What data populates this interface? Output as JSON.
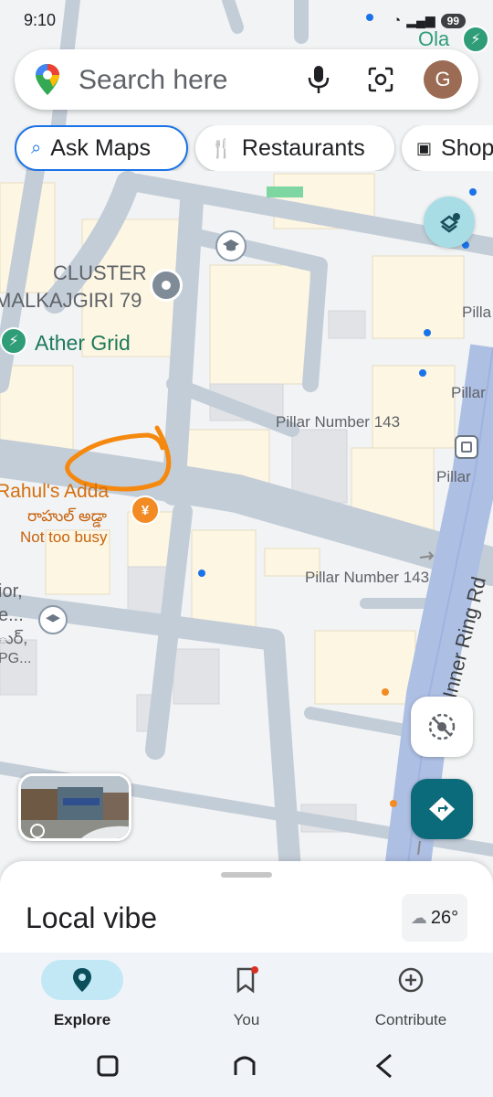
{
  "status_bar": {
    "time": "9:10",
    "battery": "99"
  },
  "search": {
    "placeholder": "Search here",
    "avatar_letter": "G"
  },
  "chips": [
    {
      "label": "Ask Maps",
      "icon": "sparkle-search-icon"
    },
    {
      "label": "Restaurants",
      "icon": "fork-knife-icon"
    },
    {
      "label": "Shop",
      "icon": "shopping-bag-icon"
    }
  ],
  "map": {
    "labels": {
      "ola": "Ola",
      "cluster_line1": "CLUSTER",
      "cluster_line2": "MALKAJGIRI 79",
      "ather": "Ather Grid",
      "pillar_143_a": "Pillar Number 143",
      "pillar_143_b": "Pillar Number 143",
      "pillar_right_1": "Pilla",
      "pillar_right_2": "Pillar",
      "pillar_right_3": "Pillar",
      "road": "Inner Ring Rd",
      "rahuls": "Rahul's Adda",
      "rahuls_telugu": "రాహుల్ అడ్డా",
      "not_busy": "Not too busy",
      "left_cut_1": "ior,",
      "left_cut_2": "e...",
      "left_cut_3": "ుర్,",
      "left_cut_4": "PG..."
    }
  },
  "sheet": {
    "title": "Local vibe",
    "temperature": "26°"
  },
  "bottom_nav": [
    {
      "label": "Explore",
      "icon": "location-pin-icon",
      "active": true
    },
    {
      "label": "You",
      "icon": "bookmark-icon",
      "active": false
    },
    {
      "label": "Contribute",
      "icon": "add-circle-icon",
      "active": false
    }
  ]
}
